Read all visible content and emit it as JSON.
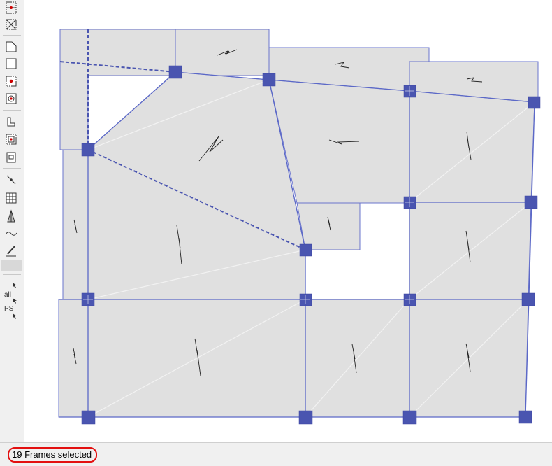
{
  "status": {
    "text": "19 Frames selected"
  },
  "toolbar": {
    "tools": [
      {
        "name": "select-frame-icon"
      },
      {
        "name": "select-cross-icon"
      },
      {
        "name": "draw-polygon-icon"
      },
      {
        "name": "draw-rectangle-icon"
      },
      {
        "name": "point-snap-icon"
      },
      {
        "name": "center-point-icon"
      },
      {
        "name": "corner-line-icon"
      },
      {
        "name": "frame-point-icon"
      },
      {
        "name": "square-point-icon"
      },
      {
        "name": "line-node-icon"
      },
      {
        "name": "grid-icon"
      },
      {
        "name": "tower-icon"
      },
      {
        "name": "wave-icon"
      },
      {
        "name": "pen-icon"
      }
    ],
    "labels": {
      "all": "all",
      "ps": "PS"
    }
  },
  "colors": {
    "slab_fill": "#e0e0e0",
    "edge": "#5b68c7",
    "node_fill": "#4a55b0",
    "selection_ring": "#e31010"
  }
}
